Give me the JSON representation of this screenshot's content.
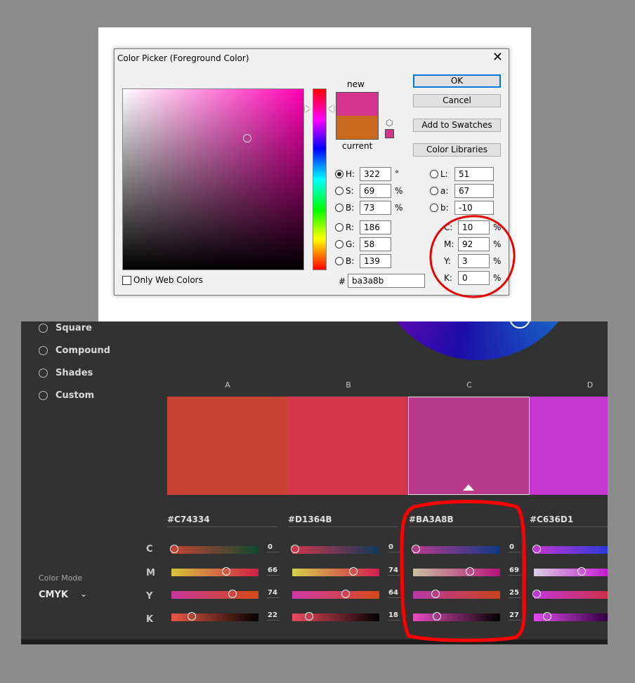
{
  "dialog": {
    "title": "Color Picker (Foreground Color)",
    "close_glyph": "✕",
    "new_label": "new",
    "current_label": "current",
    "new_color": "#d7348e",
    "current_color": "#c8691e",
    "mini_swatch_color": "#d7348e",
    "cube_glyph": "⬡",
    "buttons": {
      "ok": "OK",
      "cancel": "Cancel",
      "add_to_swatches": "Add to Swatches",
      "color_libraries": "Color Libraries"
    },
    "fields": {
      "H": {
        "label": "H:",
        "value": "322",
        "unit": "°",
        "selected": true
      },
      "S": {
        "label": "S:",
        "value": "69",
        "unit": "%"
      },
      "Bri": {
        "label": "B:",
        "value": "73",
        "unit": "%"
      },
      "R": {
        "label": "R:",
        "value": "186"
      },
      "G": {
        "label": "G:",
        "value": "58"
      },
      "Blue": {
        "label": "B:",
        "value": "139"
      },
      "L": {
        "label": "L:",
        "value": "51"
      },
      "a": {
        "label": "a:",
        "value": "67"
      },
      "b": {
        "label": "b:",
        "value": "-10"
      },
      "C": {
        "label": "C:",
        "value": "10",
        "unit": "%"
      },
      "M": {
        "label": "M:",
        "value": "92",
        "unit": "%"
      },
      "Y": {
        "label": "Y:",
        "value": "3",
        "unit": "%"
      },
      "K": {
        "label": "K:",
        "value": "0",
        "unit": "%"
      }
    },
    "hash": "#",
    "hex": "ba3a8b",
    "only_web_colors": "Only Web Colors"
  },
  "harmony": {
    "rules": [
      "Square",
      "Compound",
      "Shades",
      "Custom"
    ],
    "color_mode_label": "Color Mode",
    "color_mode_value": "CMYK",
    "channel_labels": [
      "C",
      "M",
      "Y",
      "K"
    ],
    "columns": [
      {
        "label": "A",
        "hex": "#C74334",
        "color": "#c74334",
        "cmyk": [
          "0",
          "66",
          "74",
          "22"
        ],
        "levels": [
          0.0,
          0.66,
          0.74,
          0.22
        ]
      },
      {
        "label": "B",
        "hex": "#D1364B",
        "color": "#d1364b",
        "cmyk": [
          "0",
          "74",
          "64",
          "18"
        ],
        "levels": [
          0.0,
          0.74,
          0.64,
          0.18
        ]
      },
      {
        "label": "C",
        "hex": "#BA3A8B",
        "color": "#ba3a8b",
        "cmyk": [
          "0",
          "69",
          "25",
          "27"
        ],
        "levels": [
          0.0,
          0.69,
          0.25,
          0.27
        ],
        "selected": true
      },
      {
        "label": "D",
        "hex": "#C636D1",
        "color": "#c636d1",
        "cmyk": [
          "",
          "",
          "",
          ""
        ],
        "levels": [
          0.0,
          0.69,
          0.0,
          0.16
        ]
      }
    ]
  }
}
